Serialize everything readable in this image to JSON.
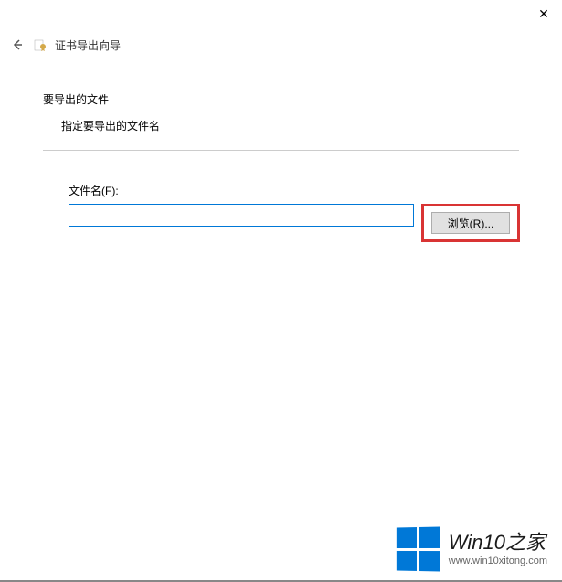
{
  "window": {
    "close_label": "✕"
  },
  "header": {
    "back_arrow": "←",
    "title": "证书导出向导"
  },
  "content": {
    "section_title": "要导出的文件",
    "section_desc": "指定要导出的文件名",
    "filename_label": "文件名(F):",
    "filename_value": "",
    "browse_label": "浏览(R)..."
  },
  "watermark": {
    "main": "Win10",
    "suffix": "之家",
    "url": "www.win10xitong.com"
  }
}
